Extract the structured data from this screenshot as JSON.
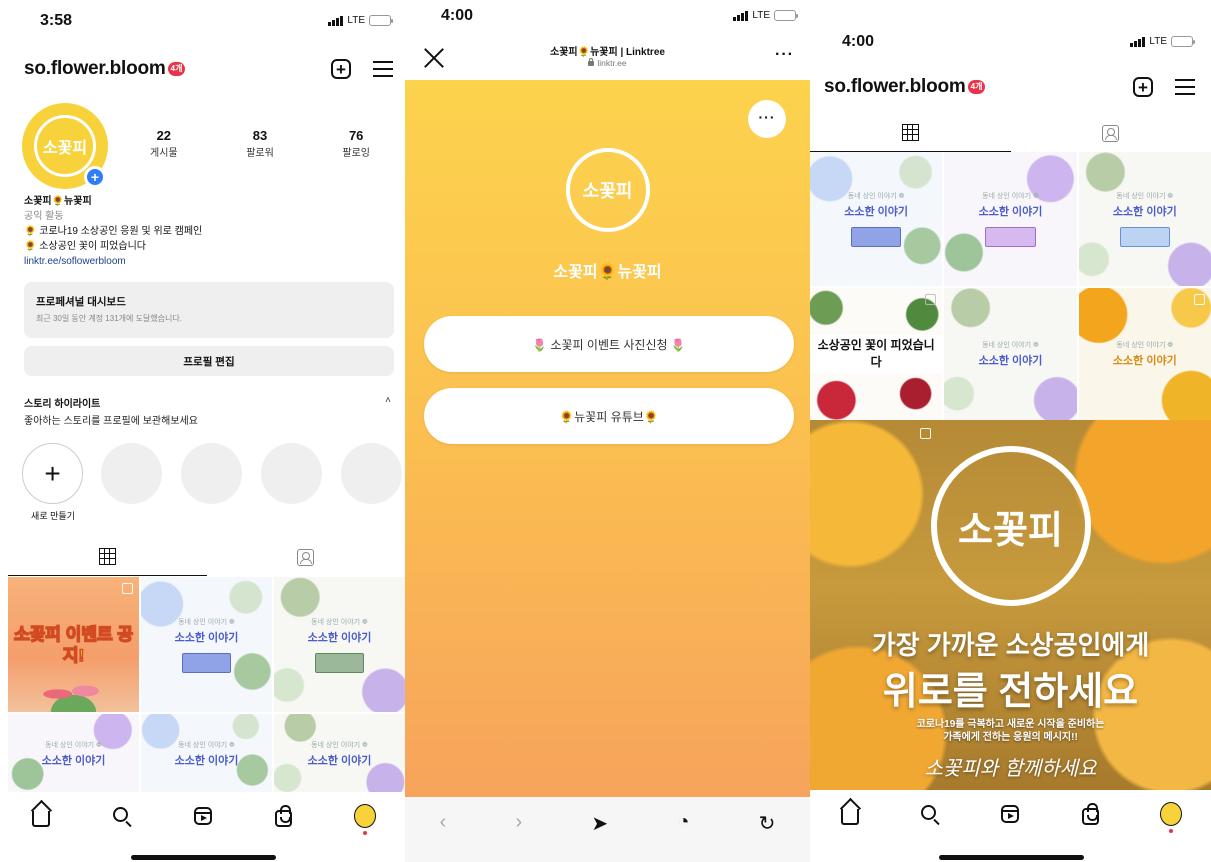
{
  "panel1": {
    "status": {
      "time": "3:58",
      "network": "LTE"
    },
    "header": {
      "username": "so.flower.bloom",
      "badge": "4개"
    },
    "stats": [
      {
        "num": "22",
        "label": "게시물"
      },
      {
        "num": "83",
        "label": "팔로워"
      },
      {
        "num": "76",
        "label": "팔로잉"
      }
    ],
    "bio": {
      "name": "소꽃피🌻뉴꽃피",
      "category": "공익 활동",
      "line1": "🌻 코로나19 소상공인 응원 및 위로 캠페인",
      "line2": "🌻 소상공인 꽃이 피었습니다",
      "link": "linktr.ee/soflowerbloom"
    },
    "dashboard": {
      "title": "프로페셔널 대시보드",
      "subtitle": "최근 30일 동안 계정 131개에 도달했습니다."
    },
    "edit_profile": "프로필 편집",
    "highlights": {
      "title": "스토리 하이라이트",
      "subtitle": "좋아하는 스토리를 프로필에 보관해보세요",
      "new_label": "새로 만들기"
    },
    "posts": [
      {
        "kind": "event",
        "text": "소꽃피 이벤트 공지!"
      },
      {
        "kind": "story",
        "small": "동네 상인 이야기 ❁",
        "big": "소소한 이야기"
      },
      {
        "kind": "story",
        "small": "동네 상인 이야기 ❁",
        "big": "소소한 이야기"
      },
      {
        "kind": "story",
        "small": "동네 상인 이야기 ❁",
        "big": "소소한 이야기"
      },
      {
        "kind": "story",
        "small": "동네 상인 이야기 ❁",
        "big": "소소한 이야기"
      },
      {
        "kind": "story",
        "small": "동네 상인 이야기 ❁",
        "big": "소소한 이야기"
      }
    ]
  },
  "panel2": {
    "status": {
      "time": "4:00",
      "network": "LTE"
    },
    "page_title": "소꽃피🌻뉴꽃피 | Linktree",
    "url": "linktr.ee",
    "logo_text": "소꽃피",
    "profile_name": "소꽃피🌻뉴꽃피",
    "links": [
      {
        "label": "🌷 소꽃피 이벤트 사진신청 🌷"
      },
      {
        "label": "🌻뉴꽃피 유튜브🌻"
      }
    ]
  },
  "panel3": {
    "status": {
      "time": "4:00",
      "network": "LTE"
    },
    "header": {
      "username": "so.flower.bloom",
      "badge": "4개"
    },
    "posts": [
      {
        "kind": "story",
        "small": "동네 상인 이야기 ❁",
        "big": "소소한 이야기"
      },
      {
        "kind": "story",
        "small": "동네 상인 이야기 ❁",
        "big": "소소한 이야기"
      },
      {
        "kind": "story",
        "small": "동네 상인 이야기 ❁",
        "big": "소소한 이야기"
      },
      {
        "kind": "title",
        "text": "소상공인 꽃이 피었습니다"
      },
      {
        "kind": "story",
        "small": "동네 상인 이야기 ❁",
        "big": "소소한 이야기"
      },
      {
        "kind": "story",
        "small": "동네 상인 이야기 ❁",
        "big": "소소한 이야기"
      }
    ],
    "hero": {
      "logo": "소꽃피",
      "line1": "가장 가까운 소상공인에게",
      "line2": "위로를 전하세요",
      "sub1": "코로나19를 극복하고 새로운 시작을 준비하는",
      "sub2": "가족에게 전하는 응원의 메시지!!",
      "script": "소꽃피와 함께하세요"
    }
  },
  "colors": {
    "brand_yellow": "#f7d23a",
    "link_blue": "#1c3f8a",
    "badge_red": "#e8334a",
    "avatar_plus_blue": "#2f7df6"
  }
}
